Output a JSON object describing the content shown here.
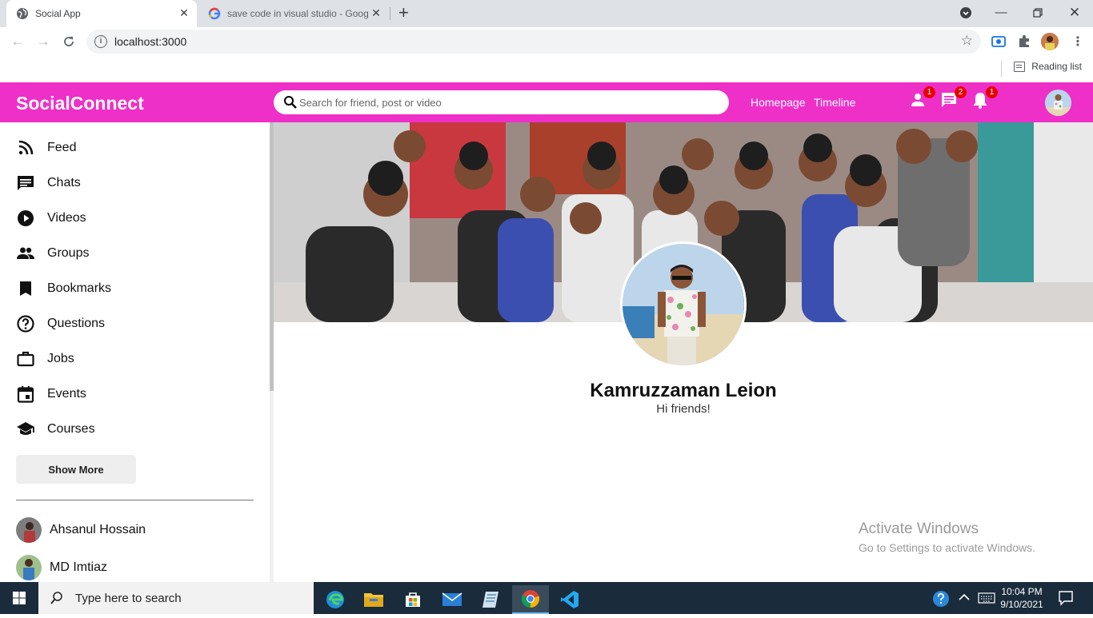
{
  "browser": {
    "tabs": [
      {
        "title": "Social App",
        "active": true,
        "icon": "globe-icon"
      },
      {
        "title": "save code in visual studio - Goog",
        "active": false,
        "icon": "google-icon"
      }
    ],
    "new_tab": "+",
    "url": "localhost:3000",
    "reading_list": "Reading list"
  },
  "app": {
    "logo": "SocialConnect",
    "search_placeholder": "Search for friend, post or video",
    "links": [
      "Homepage",
      "Timeline"
    ],
    "badges": {
      "friends": "1",
      "messages": "2",
      "notifications": "1"
    },
    "brand_color": "#ee30c8"
  },
  "sidebar": {
    "items": [
      {
        "label": "Feed",
        "icon": "rss-feed-icon"
      },
      {
        "label": "Chats",
        "icon": "chat-icon"
      },
      {
        "label": "Videos",
        "icon": "play-circle-icon"
      },
      {
        "label": "Groups",
        "icon": "group-icon"
      },
      {
        "label": "Bookmarks",
        "icon": "bookmark-icon"
      },
      {
        "label": "Questions",
        "icon": "help-circle-icon"
      },
      {
        "label": "Jobs",
        "icon": "briefcase-icon"
      },
      {
        "label": "Events",
        "icon": "calendar-icon"
      },
      {
        "label": "Courses",
        "icon": "school-icon"
      }
    ],
    "show_more": "Show More",
    "friends": [
      {
        "name": "Ahsanul Hossain"
      },
      {
        "name": "MD Imtiaz"
      }
    ]
  },
  "profile": {
    "name": "Kamruzzaman Leion",
    "description": "Hi friends!"
  },
  "watermark": {
    "line1": "Activate Windows",
    "line2": "Go to Settings to activate Windows."
  },
  "taskbar": {
    "search_text": "Type here to search",
    "time": "10:04 PM",
    "date": "9/10/2021"
  }
}
